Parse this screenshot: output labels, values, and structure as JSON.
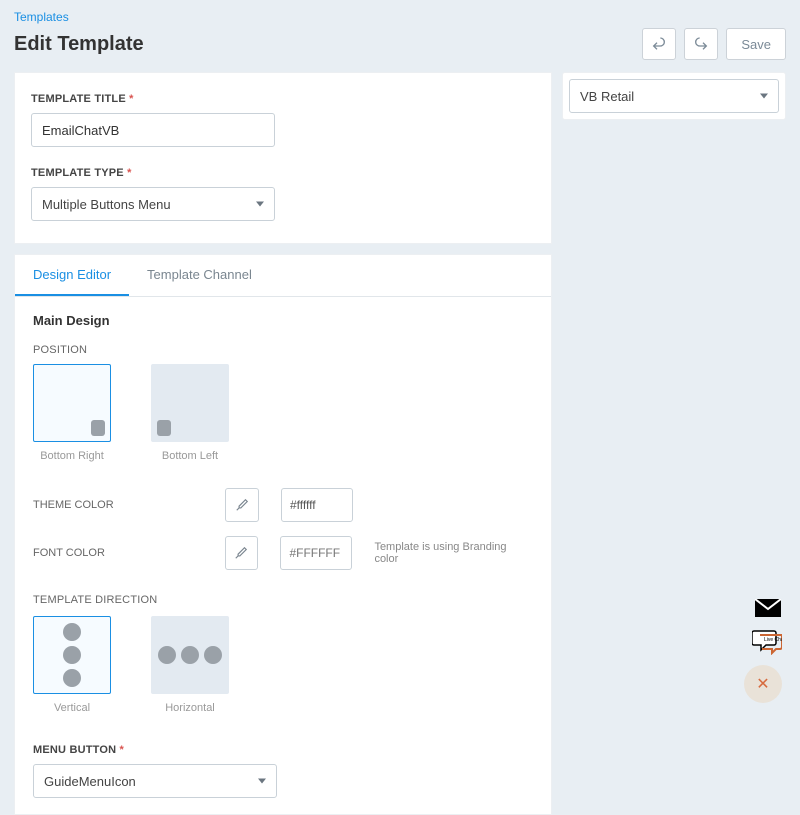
{
  "breadcrumb": {
    "parent": "Templates"
  },
  "page": {
    "title": "Edit Template"
  },
  "header": {
    "undo_tip": "Undo",
    "redo_tip": "Redo",
    "save_label": "Save"
  },
  "form": {
    "title_label": "TEMPLATE TITLE",
    "title_value": "EmailChatVB",
    "type_label": "TEMPLATE TYPE",
    "type_value": "Multiple Buttons Menu"
  },
  "tabs": {
    "design": "Design Editor",
    "channel": "Template Channel"
  },
  "editor": {
    "main_title": "Main Design",
    "position_label": "POSITION",
    "position_br": "Bottom Right",
    "position_bl": "Bottom Left",
    "theme_label": "THEME COLOR",
    "theme_value": "#ffffff",
    "font_label": "FONT COLOR",
    "font_placeholder": "#FFFFFF",
    "font_note": "Template is using Branding color",
    "dir_label": "TEMPLATE DIRECTION",
    "dir_v": "Vertical",
    "dir_h": "Horizontal",
    "menu_label": "MENU BUTTON",
    "menu_value": "GuideMenuIcon"
  },
  "side": {
    "brand_value": "VB Retail"
  },
  "required_marker": "*",
  "float": {
    "chat_text": "Live Chat"
  }
}
